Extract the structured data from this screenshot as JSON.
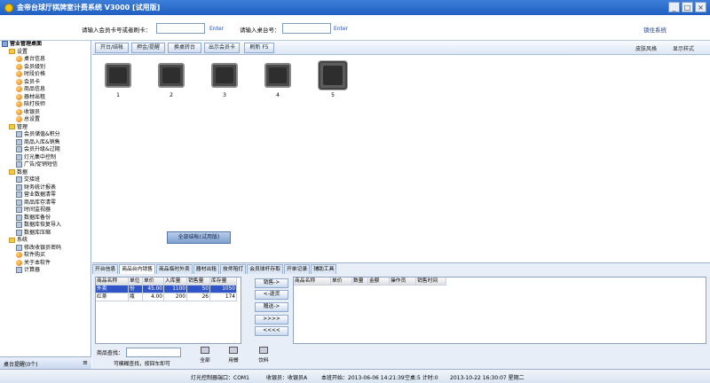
{
  "window": {
    "title": "金帝台球厅棋牌室计费系统 V3000 [试用版]"
  },
  "search": {
    "card_label": "请输入会员卡号或者刷卡：",
    "card_enter": "Enter",
    "table_label": "请输入桌台号：",
    "table_enter": "Enter",
    "lock_label": "锁住系统"
  },
  "tree": [
    {
      "label": "营业管理桌面",
      "icon": "home-icon",
      "depth": 0
    },
    {
      "label": "设置",
      "icon": "folder-icon",
      "depth": 1
    },
    {
      "label": "桌台信息",
      "icon": "orange-ball-icon",
      "depth": 2
    },
    {
      "label": "会员级别",
      "icon": "orange-ball-icon",
      "depth": 2
    },
    {
      "label": "时段价格",
      "icon": "orange-ball-icon",
      "depth": 2
    },
    {
      "label": "会员卡",
      "icon": "orange-ball-icon",
      "depth": 2
    },
    {
      "label": "商品信息",
      "icon": "orange-ball-icon",
      "depth": 2
    },
    {
      "label": "器材出租",
      "icon": "orange-ball-icon",
      "depth": 2
    },
    {
      "label": "陪打技师",
      "icon": "orange-ball-icon",
      "depth": 2
    },
    {
      "label": "收银员",
      "icon": "orange-ball-icon",
      "depth": 2
    },
    {
      "label": "总设置",
      "icon": "orange-ball-icon",
      "depth": 2
    },
    {
      "label": "管理",
      "icon": "folder-icon",
      "depth": 1
    },
    {
      "label": "会员储值&积分",
      "icon": "card-icon",
      "depth": 2
    },
    {
      "label": "商品入库&销售",
      "icon": "goods-icon",
      "depth": 2
    },
    {
      "label": "会员升级&过期",
      "icon": "member-icon",
      "depth": 2
    },
    {
      "label": "灯光集中控制",
      "icon": "bulb-icon",
      "depth": 2
    },
    {
      "label": "广告/促销短信",
      "icon": "sms-icon",
      "depth": 2
    },
    {
      "label": "数据",
      "icon": "folder-icon",
      "depth": 1
    },
    {
      "label": "交接班",
      "icon": "shift-icon",
      "depth": 2
    },
    {
      "label": "财务统计报表",
      "icon": "report-icon",
      "depth": 2
    },
    {
      "label": "营业数据清零",
      "icon": "clear-icon",
      "depth": 2
    },
    {
      "label": "商品库存清零",
      "icon": "stock-icon",
      "depth": 2
    },
    {
      "label": "时间监视器",
      "icon": "clock-icon",
      "depth": 2
    },
    {
      "label": "数据库备份",
      "icon": "backup-icon",
      "depth": 2
    },
    {
      "label": "数据库恢复导入",
      "icon": "restore-icon",
      "depth": 2
    },
    {
      "label": "数据库压缩",
      "icon": "compress-icon",
      "depth": 2
    },
    {
      "label": "系统",
      "icon": "folder-icon",
      "depth": 1
    },
    {
      "label": "修改收银员密码",
      "icon": "password-icon",
      "depth": 2
    },
    {
      "label": "软件购买",
      "icon": "orange-ball-icon",
      "depth": 2
    },
    {
      "label": "关于本软件",
      "icon": "orange-ball-icon",
      "depth": 2
    },
    {
      "label": "计算器",
      "icon": "calculator-icon",
      "depth": 2
    }
  ],
  "left_bottom": {
    "label": "桌台提醒(0个)"
  },
  "toolbar": {
    "buttons": [
      "开台/结帐",
      "押金/提醒",
      "换桌转台",
      "出示会员卡",
      "刷新 F5"
    ],
    "skin": "皮肤风格",
    "display": "显示样式"
  },
  "tables": [
    {
      "number": "1",
      "selected": false
    },
    {
      "number": "2",
      "selected": false
    },
    {
      "number": "3",
      "selected": false
    },
    {
      "number": "4",
      "selected": false
    },
    {
      "number": "5",
      "selected": true
    }
  ],
  "checkout_all": "全部结帐(试用版)",
  "bottom": {
    "tabs": [
      "开台信息",
      "商品台内销售",
      "商品临时外卖",
      "器材出租",
      "技师陪打",
      "会员球杆存取",
      "开单记录",
      "辅助工具"
    ],
    "active_tab": 1,
    "left_grid": {
      "headers": [
        "商品名称",
        "单位",
        "单价",
        "入库量",
        "销售量",
        "库存量"
      ],
      "rows": [
        [
          "外卖",
          "份",
          "45.00",
          "1100",
          "50",
          "1050"
        ],
        [
          "红茶",
          "瓶",
          "4.00",
          "200",
          "26",
          "174"
        ]
      ]
    },
    "right_grid": {
      "headers": [
        "商品名称",
        "单价",
        "数量",
        "金额",
        "操作员",
        "销售时间"
      ]
    },
    "move_buttons": [
      "销售->",
      "<-退货",
      "赠送->",
      ">>>>",
      "<<<<"
    ],
    "search_label": "商品查找：",
    "search_hint": "可模糊查找，按回车即可",
    "categories": [
      "全部",
      "用餐",
      "饮料"
    ]
  },
  "status": {
    "light": "灯光控制器端口：COM1",
    "cashier": "收银员：收银员A",
    "shift": "本班开始：2013-06-06 14:21:39",
    "vacant": "空桌:5 计时:0",
    "clock": "2013-10-22 16:30:07 星期二"
  }
}
